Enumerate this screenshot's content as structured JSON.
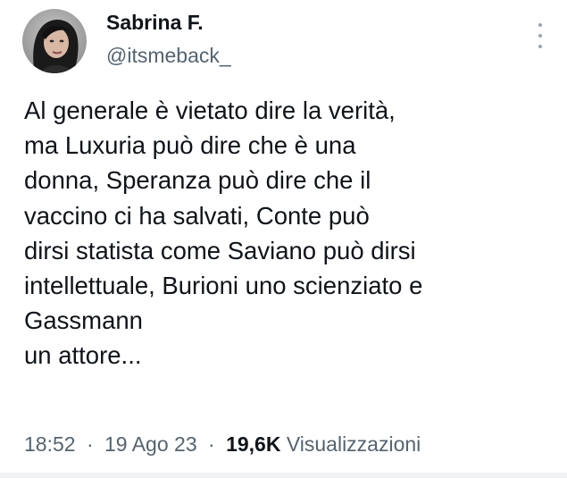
{
  "author": {
    "display_name": "Sabrina F.",
    "handle": "@itsmeback_"
  },
  "tweet": {
    "lines": [
      "Al generale è vietato dire la verità,",
      "ma Luxuria può dire che è una",
      "donna, Speranza può dire che il",
      "vaccino ci ha salvati, Conte può",
      "dirsi statista come Saviano può dirsi",
      "intellettuale, Burioni uno scienziato e",
      "Gassmann",
      "un attore..."
    ]
  },
  "meta": {
    "time": "18:52",
    "separator": "·",
    "date": "19 Ago 23",
    "views_count": "19,6K",
    "views_label": "Visualizzazioni"
  },
  "icons": {
    "more": "more-vertical-icon"
  }
}
